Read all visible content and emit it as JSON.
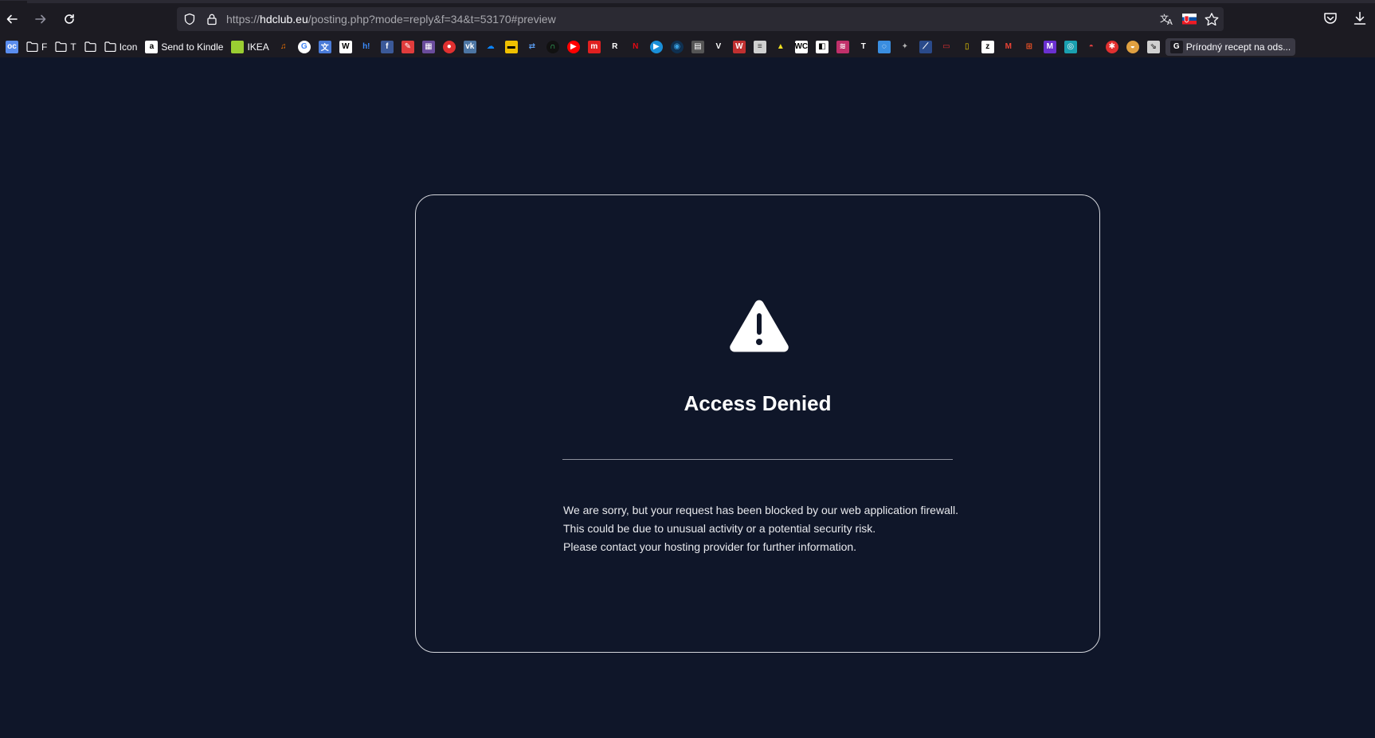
{
  "browser": {
    "url_scheme": "https://",
    "url_host": "hdclub.eu",
    "url_path": "/posting.php?mode=reply&f=34&t=53170#preview"
  },
  "bookmarks": [
    {
      "type": "favicon",
      "text": "oc",
      "color": "#5a8dee",
      "icon": "oc-icon"
    },
    {
      "type": "folder",
      "label": "F"
    },
    {
      "type": "folder",
      "label": "T"
    },
    {
      "type": "folder",
      "label": ""
    },
    {
      "type": "folder",
      "label": "Icon"
    },
    {
      "type": "favicon",
      "text": "a",
      "color": "#ffffff",
      "fg": "#000000",
      "label": "Send to Kindle",
      "icon": "amazon-icon"
    },
    {
      "type": "favicon",
      "text": "",
      "color": "#9acd32",
      "label": "IKEA",
      "icon": "ikea-icon"
    },
    {
      "type": "favicon",
      "text": "♫",
      "color": "#1c1b22",
      "fg": "#ff7a00",
      "icon": "headphones-icon"
    },
    {
      "type": "favicon",
      "text": "G",
      "color": "#ffffff",
      "fg": "#4285f4",
      "round": true,
      "icon": "google-icon"
    },
    {
      "type": "favicon",
      "text": "文",
      "color": "#4a7bd8",
      "icon": "translate-icon"
    },
    {
      "type": "favicon",
      "text": "W",
      "color": "#ffffff",
      "fg": "#000000",
      "icon": "wikipedia-icon"
    },
    {
      "type": "favicon",
      "text": "h!",
      "color": "#1c1b22",
      "fg": "#3c8dff",
      "icon": "h-icon"
    },
    {
      "type": "favicon",
      "text": "f",
      "color": "#3b5998",
      "icon": "facebook-icon"
    },
    {
      "type": "favicon",
      "text": "✎",
      "color": "#e03c3c",
      "icon": "pen-icon"
    },
    {
      "type": "favicon",
      "text": "▦",
      "color": "#6a4c9c",
      "icon": "grid-icon"
    },
    {
      "type": "favicon",
      "text": "●",
      "color": "#e03030",
      "round": true,
      "icon": "opera-icon"
    },
    {
      "type": "favicon",
      "text": "vk",
      "color": "#4c75a3",
      "icon": "vk-icon"
    },
    {
      "type": "favicon",
      "text": "☁",
      "color": "#1c1b22",
      "fg": "#0a84ff",
      "icon": "onedrive-icon"
    },
    {
      "type": "favicon",
      "text": "▬",
      "color": "#f0c000",
      "fg": "#000000",
      "icon": "imdb-icon"
    },
    {
      "type": "favicon",
      "text": "⇄",
      "color": "#1c1b22",
      "fg": "#5a9cf0",
      "icon": "transfer-icon"
    },
    {
      "type": "favicon",
      "text": "∩",
      "color": "#111111",
      "fg": "#3cd070",
      "round": true,
      "icon": "headset-icon"
    },
    {
      "type": "favicon",
      "text": "▶",
      "color": "#ff0000",
      "round": true,
      "icon": "youtube-icon"
    },
    {
      "type": "favicon",
      "text": "m",
      "color": "#e02020",
      "icon": "m-icon"
    },
    {
      "type": "favicon",
      "text": "R",
      "color": "#1c1b22",
      "fg": "#ffffff",
      "icon": "r-icon"
    },
    {
      "type": "favicon",
      "text": "N",
      "color": "#1c1b22",
      "fg": "#e50914",
      "icon": "netflix-icon"
    },
    {
      "type": "favicon",
      "text": "▶",
      "color": "#1a8fd8",
      "round": true,
      "icon": "play-icon"
    },
    {
      "type": "favicon",
      "text": "◉",
      "color": "#0f3050",
      "fg": "#3aa0e0",
      "round": true,
      "icon": "steam-icon"
    },
    {
      "type": "favicon",
      "text": "▤",
      "color": "#555555",
      "icon": "image-icon"
    },
    {
      "type": "favicon",
      "text": "V",
      "color": "#1c1b22",
      "fg": "#ffffff",
      "icon": "v-icon"
    },
    {
      "type": "favicon",
      "text": "W",
      "color": "#c03030",
      "icon": "w-icon"
    },
    {
      "type": "favicon",
      "text": "≡",
      "color": "#d0d0d0",
      "fg": "#333333",
      "icon": "document-icon"
    },
    {
      "type": "favicon",
      "text": "▲",
      "color": "#1c1b22",
      "fg": "#f0e020",
      "icon": "triangle-icon"
    },
    {
      "type": "favicon",
      "text": "WC",
      "color": "#ffffff",
      "fg": "#000000",
      "icon": "wc-icon"
    },
    {
      "type": "favicon",
      "text": "◧",
      "color": "#ffffff",
      "fg": "#000000",
      "icon": "book-icon"
    },
    {
      "type": "favicon",
      "text": "≋",
      "color": "#c0306a",
      "icon": "stripes-icon"
    },
    {
      "type": "favicon",
      "text": "T",
      "color": "#1c1b22",
      "fg": "#ffffff",
      "icon": "t-icon"
    },
    {
      "type": "favicon",
      "text": "◌",
      "color": "#3a8ee0",
      "icon": "chat-icon"
    },
    {
      "type": "favicon",
      "text": "✦",
      "color": "#1c1b22",
      "fg": "#b0b0b0",
      "icon": "star-icon"
    },
    {
      "type": "favicon",
      "text": "⟋",
      "color": "#2a4a8a",
      "icon": "slash-icon"
    },
    {
      "type": "favicon",
      "text": "▭",
      "color": "#1c1b22",
      "fg": "#e03030",
      "icon": "frame-icon"
    },
    {
      "type": "favicon",
      "text": "▯",
      "color": "#1c1b22",
      "fg": "#f0d000",
      "icon": "natgeo-icon"
    },
    {
      "type": "favicon",
      "text": "z",
      "color": "#ffffff",
      "fg": "#000000",
      "icon": "z-icon"
    },
    {
      "type": "favicon",
      "text": "M",
      "color": "#1c1b22",
      "fg": "#ea4335",
      "icon": "gmail-icon"
    },
    {
      "type": "favicon",
      "text": "⊞",
      "color": "#1c1b22",
      "fg": "#f35325",
      "icon": "microsoft-icon"
    },
    {
      "type": "favicon",
      "text": "M",
      "color": "#6a30d0",
      "icon": "m-purple-icon"
    },
    {
      "type": "favicon",
      "text": "◎",
      "color": "#1aa0b0",
      "icon": "circle-icon"
    },
    {
      "type": "favicon",
      "text": "◓",
      "color": "#1c1b22",
      "fg": "#e04040",
      "icon": "car-icon"
    },
    {
      "type": "favicon",
      "text": "✱",
      "color": "#e03030",
      "round": true,
      "icon": "asterisk-icon"
    },
    {
      "type": "favicon",
      "text": "◒",
      "color": "#e0a040",
      "round": true,
      "icon": "bowl-icon"
    },
    {
      "type": "favicon",
      "text": "⇘",
      "color": "#d0d0d0",
      "fg": "#333333",
      "icon": "arrow-icon"
    },
    {
      "type": "favicon",
      "text": "G",
      "color": "#1c1b22",
      "fg": "#ffffff",
      "label": "Prírodný recept na ods...",
      "icon": "g-icon",
      "highlight": true
    }
  ],
  "page": {
    "title": "Access Denied",
    "message_lines": [
      "We are sorry, but your request has been blocked by our web application firewall.",
      "This could be due to unusual activity or a potential security risk.",
      "Please contact your hosting provider for further information."
    ]
  },
  "colors": {
    "page_bg": "#0f1629",
    "chrome_bg": "#1c1b22",
    "urlbar_bg": "#2b2a33",
    "card_border": "#d4d6dc"
  }
}
